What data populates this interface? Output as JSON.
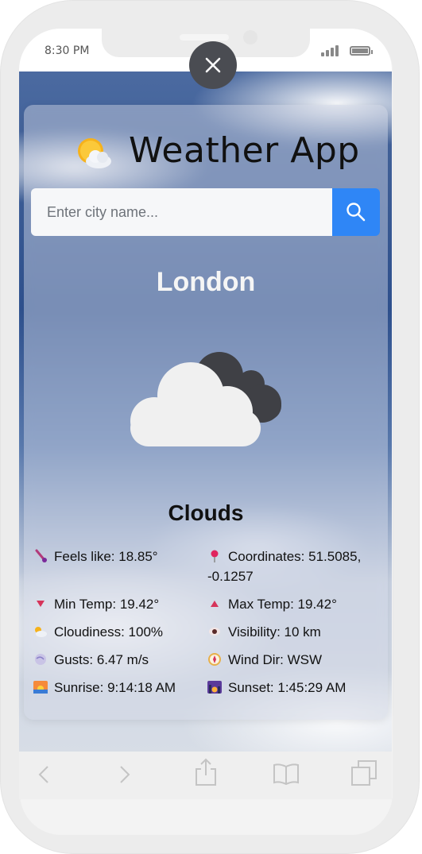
{
  "status_bar": {
    "time": "8:30 PM"
  },
  "app": {
    "title": "Weather App"
  },
  "search": {
    "placeholder": "Enter city name..."
  },
  "weather": {
    "city": "London",
    "condition": "Clouds",
    "details": {
      "feels_like": "Feels like: 18.85°",
      "coordinates_line1": "Coordinates: 51.5085,",
      "coordinates_line2": "-0.1257",
      "min_temp": "Min Temp: 19.42°",
      "max_temp": "Max Temp: 19.42°",
      "cloudiness": "Cloudiness: 100%",
      "visibility": "Visibility: 10 km",
      "gusts": "Gusts: 6.47 m/s",
      "wind_dir": "Wind Dir: WSW",
      "sunrise": "Sunrise: 9:14:18 AM",
      "sunset": "Sunset: 1:45:29 AM"
    }
  },
  "colors": {
    "search_button": "#2f86f6",
    "close_button": "#4a4c52",
    "city_text": "#f5f5f5"
  },
  "icons": {
    "title": "sun-behind-cloud-icon",
    "search": "search-icon",
    "close": "close-icon",
    "weather": "clouds-icon",
    "feels_like": "thermometer-icon",
    "coordinates": "pushpin-icon",
    "min_temp": "triangle-down-icon",
    "max_temp": "triangle-up-icon",
    "cloudiness": "cloud-icon",
    "visibility": "eye-icon",
    "gusts": "wind-icon",
    "wind_dir": "compass-icon",
    "sunrise": "sunrise-icon",
    "sunset": "sunset-icon",
    "nav": [
      "back-icon",
      "forward-icon",
      "share-icon",
      "bookmarks-icon",
      "tabs-icon"
    ]
  }
}
